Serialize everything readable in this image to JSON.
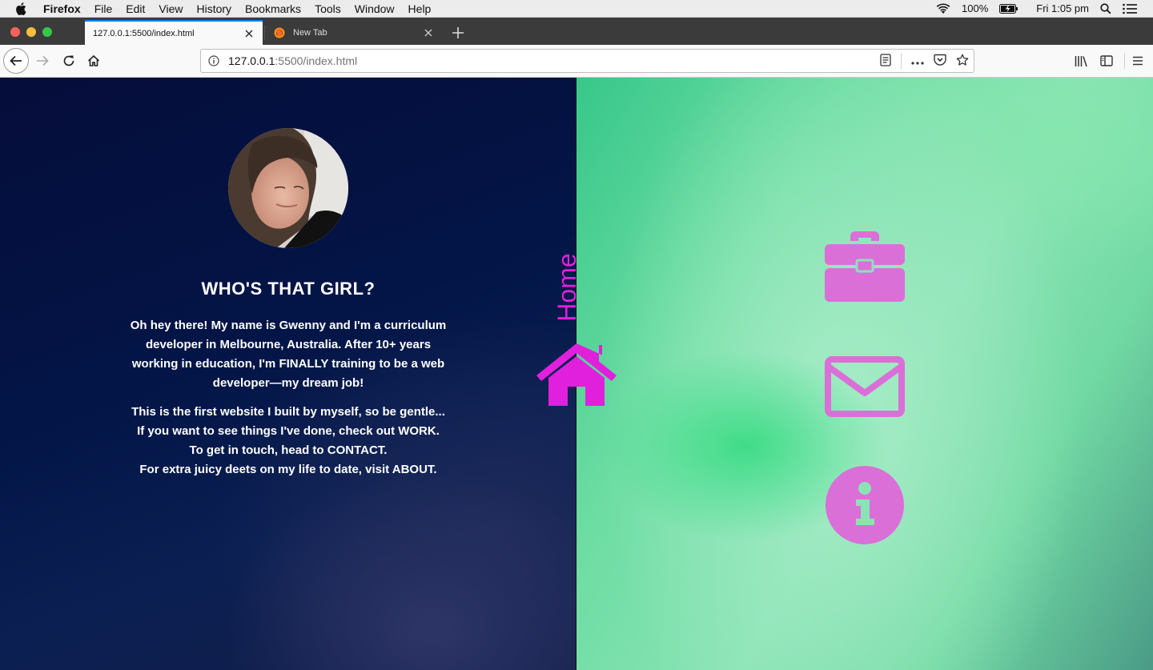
{
  "menubar": {
    "app": "Firefox",
    "items": [
      "File",
      "Edit",
      "View",
      "History",
      "Bookmarks",
      "Tools",
      "Window",
      "Help"
    ],
    "battery": "100%",
    "clock": "Fri 1:05 pm"
  },
  "tabs": [
    {
      "label": "127.0.0.1:5500/index.html",
      "active": true
    },
    {
      "label": "New Tab",
      "active": false
    }
  ],
  "urlbar": {
    "host": "127.0.0.1",
    "path": ":5500/index.html"
  },
  "page": {
    "heading": "WHO'S THAT GIRL?",
    "bio_p1": "Oh hey there! My name is Gwenny and I'm a curriculum developer in Melbourne, Australia. After 10+ years working in education, I'm FINALLY training to be a web developer—my dream job!",
    "bio_p2_lines": [
      "This is the first website I built by myself, so be gentle...",
      "If you want to see things I've done, check out WORK.",
      "To get in touch, head to CONTACT.",
      "For extra juicy deets on my life to date, visit ABOUT."
    ],
    "home_label": "Home",
    "nav_icons": [
      "briefcase-icon",
      "envelope-icon",
      "info-icon",
      "home-icon"
    ]
  },
  "colors": {
    "accent_magenta": "#e020dd",
    "icon_pink": "#db6fd8",
    "left_bg": "#031547",
    "right_bg": "#6ddda3"
  }
}
